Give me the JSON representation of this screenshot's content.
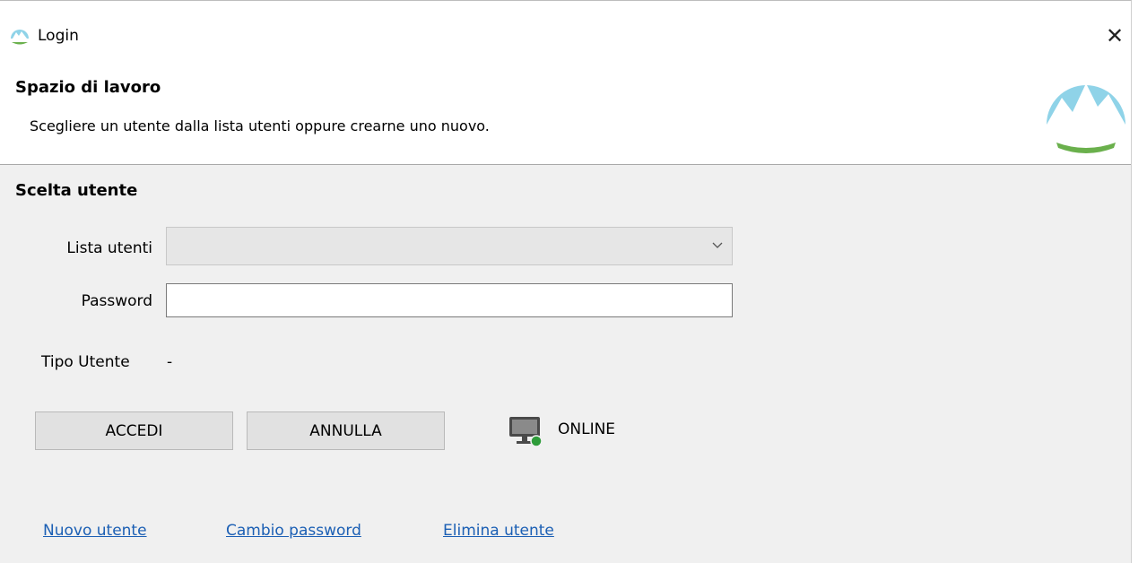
{
  "window": {
    "title": "Login",
    "close_glyph": "✕",
    "app_icon": "mountain-logo-icon"
  },
  "header": {
    "title": "Spazio di lavoro",
    "description": "Scegliere un utente dalla lista utenti oppure crearne uno nuovo."
  },
  "section": {
    "title": "Scelta utente"
  },
  "form": {
    "user_list_label": "Lista utenti",
    "user_list_value": "",
    "password_label": "Password",
    "password_value": "",
    "user_type_label": "Tipo Utente",
    "user_type_value": "-"
  },
  "buttons": {
    "login": "ACCEDI",
    "cancel": "ANNULLA"
  },
  "status": {
    "text": "ONLINE",
    "icon": "monitor-online-icon"
  },
  "links": {
    "new_user": "Nuovo utente",
    "change_password": "Cambio password",
    "delete_user": "Elimina utente"
  },
  "colors": {
    "logo_sky": "#8fd3e8",
    "logo_green": "#6ab04c",
    "link": "#1b5fb4",
    "online_dot": "#2e9c3a"
  }
}
